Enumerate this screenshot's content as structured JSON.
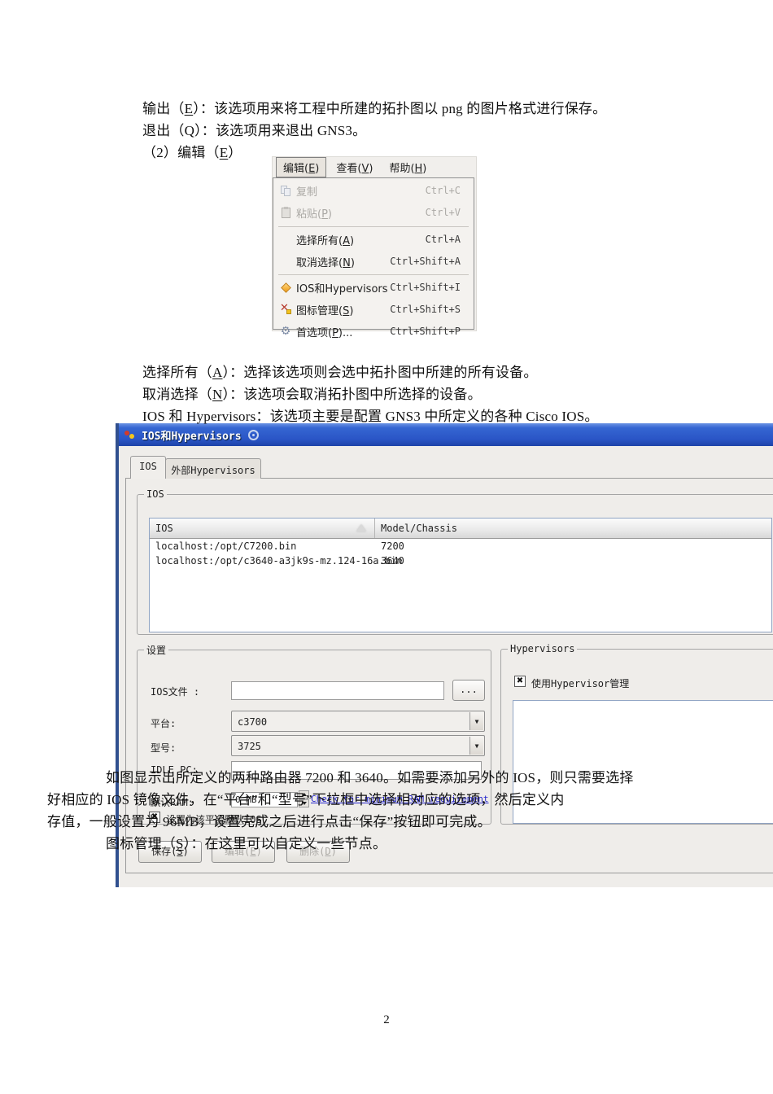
{
  "doc": {
    "para_output": "输出（E）：该选项用来将工程中所建的拓扑图以 png 的图片格式进行保存。",
    "para_quit": "退出（Q）：该选项用来退出 GNS3。",
    "para_edit_heading": "（2）编辑（E）",
    "para_select_all": "选择所有（A）：选择该选项则会选中拓扑图中所建的所有设备。",
    "para_deselect": "取消选择（N）：该选项会取消拓扑图中所选择的设备。",
    "para_ios_hyper": "IOS 和 Hypervisors：该选项主要是配置 GNS3 中所定义的各种 Cisco IOS。",
    "para_fig_line1": "如图显示出所定义的两种路由器 7200 和 3640。如需要添加另外的 IOS，则只需要选择",
    "para_fig_line2": "好相应的 IOS 镜像文件，在“平台”和“型号”下拉框中选择相对应的选项，然后定义内",
    "para_fig_line3": "存值，一般设置为 96MB，设置完成之后进行点击“保存”按钮即可完成。",
    "para_symbol_mgr": "图标管理（S）：在这里可以自定义一些节点。",
    "page_number": "2"
  },
  "menu": {
    "bar": [
      {
        "label": "编辑(E)"
      },
      {
        "label": "查看(V)"
      },
      {
        "label": "帮助(H)"
      }
    ],
    "items": [
      {
        "label": "复制",
        "shortcut": "Ctrl+C"
      },
      {
        "label": "粘贴(P)",
        "shortcut": "Ctrl+V"
      },
      {
        "label": "选择所有(A)",
        "shortcut": "Ctrl+A"
      },
      {
        "label": "取消选择(N)",
        "shortcut": "Ctrl+Shift+A"
      },
      {
        "label": "IOS和Hypervisors",
        "shortcut": "Ctrl+Shift+I"
      },
      {
        "label": "图标管理(S)",
        "shortcut": "Ctrl+Shift+S"
      },
      {
        "label": "首选项(P)...",
        "shortcut": "Ctrl+Shift+P"
      }
    ]
  },
  "dialog": {
    "title": "IOS和Hypervisors",
    "tabs": [
      {
        "label": "IOS"
      },
      {
        "label": "外部Hypervisors"
      }
    ],
    "ios_group": {
      "legend": "IOS",
      "table": {
        "col1": "IOS",
        "col2": "Model/Chassis",
        "rows": [
          {
            "ios": "localhost:/opt/C7200.bin",
            "model": "7200"
          },
          {
            "ios": "localhost:/opt/c3640-a3jk9s-mz.124-16a.bin",
            "model": "3640"
          }
        ]
      }
    },
    "settings": {
      "legend": "设置",
      "ios_file_label": "IOS文件 :",
      "ios_file_value": "",
      "browse_label": "...",
      "platform_label": "平台:",
      "platform_value": "c3700",
      "model_label": "型号:",
      "model_value": "3725",
      "idlepc_label": "IDLE PC:",
      "idlepc_value": "",
      "ram_label": "默认RAM:",
      "ram_value": "0 MB",
      "ram_link": "Check for minimum RAM requirement",
      "default_ios_checkbox": "设置为该平台默认IOS"
    },
    "hypervisors": {
      "legend": "Hypervisors",
      "manage_checkbox": "使用Hypervisor管理"
    },
    "buttons": {
      "save": "保存(S)",
      "edit": "编辑(E)",
      "delete": "删除(D)"
    }
  },
  "icons": {
    "dropdown_arrow": "▼",
    "checkbox_mark": "✖",
    "gear": "⚙",
    "scissors": "✕"
  }
}
